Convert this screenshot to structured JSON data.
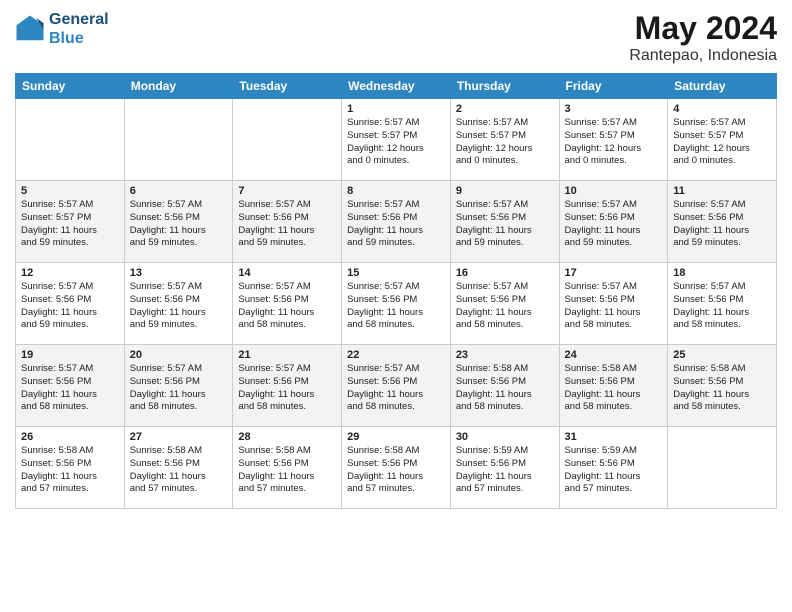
{
  "header": {
    "logo_line1": "General",
    "logo_line2": "Blue",
    "month": "May 2024",
    "location": "Rantepao, Indonesia"
  },
  "weekdays": [
    "Sunday",
    "Monday",
    "Tuesday",
    "Wednesday",
    "Thursday",
    "Friday",
    "Saturday"
  ],
  "weeks": [
    [
      {
        "day": "",
        "info": ""
      },
      {
        "day": "",
        "info": ""
      },
      {
        "day": "",
        "info": ""
      },
      {
        "day": "1",
        "info": "Sunrise: 5:57 AM\nSunset: 5:57 PM\nDaylight: 12 hours\nand 0 minutes."
      },
      {
        "day": "2",
        "info": "Sunrise: 5:57 AM\nSunset: 5:57 PM\nDaylight: 12 hours\nand 0 minutes."
      },
      {
        "day": "3",
        "info": "Sunrise: 5:57 AM\nSunset: 5:57 PM\nDaylight: 12 hours\nand 0 minutes."
      },
      {
        "day": "4",
        "info": "Sunrise: 5:57 AM\nSunset: 5:57 PM\nDaylight: 12 hours\nand 0 minutes."
      }
    ],
    [
      {
        "day": "5",
        "info": "Sunrise: 5:57 AM\nSunset: 5:57 PM\nDaylight: 11 hours\nand 59 minutes."
      },
      {
        "day": "6",
        "info": "Sunrise: 5:57 AM\nSunset: 5:56 PM\nDaylight: 11 hours\nand 59 minutes."
      },
      {
        "day": "7",
        "info": "Sunrise: 5:57 AM\nSunset: 5:56 PM\nDaylight: 11 hours\nand 59 minutes."
      },
      {
        "day": "8",
        "info": "Sunrise: 5:57 AM\nSunset: 5:56 PM\nDaylight: 11 hours\nand 59 minutes."
      },
      {
        "day": "9",
        "info": "Sunrise: 5:57 AM\nSunset: 5:56 PM\nDaylight: 11 hours\nand 59 minutes."
      },
      {
        "day": "10",
        "info": "Sunrise: 5:57 AM\nSunset: 5:56 PM\nDaylight: 11 hours\nand 59 minutes."
      },
      {
        "day": "11",
        "info": "Sunrise: 5:57 AM\nSunset: 5:56 PM\nDaylight: 11 hours\nand 59 minutes."
      }
    ],
    [
      {
        "day": "12",
        "info": "Sunrise: 5:57 AM\nSunset: 5:56 PM\nDaylight: 11 hours\nand 59 minutes."
      },
      {
        "day": "13",
        "info": "Sunrise: 5:57 AM\nSunset: 5:56 PM\nDaylight: 11 hours\nand 59 minutes."
      },
      {
        "day": "14",
        "info": "Sunrise: 5:57 AM\nSunset: 5:56 PM\nDaylight: 11 hours\nand 58 minutes."
      },
      {
        "day": "15",
        "info": "Sunrise: 5:57 AM\nSunset: 5:56 PM\nDaylight: 11 hours\nand 58 minutes."
      },
      {
        "day": "16",
        "info": "Sunrise: 5:57 AM\nSunset: 5:56 PM\nDaylight: 11 hours\nand 58 minutes."
      },
      {
        "day": "17",
        "info": "Sunrise: 5:57 AM\nSunset: 5:56 PM\nDaylight: 11 hours\nand 58 minutes."
      },
      {
        "day": "18",
        "info": "Sunrise: 5:57 AM\nSunset: 5:56 PM\nDaylight: 11 hours\nand 58 minutes."
      }
    ],
    [
      {
        "day": "19",
        "info": "Sunrise: 5:57 AM\nSunset: 5:56 PM\nDaylight: 11 hours\nand 58 minutes."
      },
      {
        "day": "20",
        "info": "Sunrise: 5:57 AM\nSunset: 5:56 PM\nDaylight: 11 hours\nand 58 minutes."
      },
      {
        "day": "21",
        "info": "Sunrise: 5:57 AM\nSunset: 5:56 PM\nDaylight: 11 hours\nand 58 minutes."
      },
      {
        "day": "22",
        "info": "Sunrise: 5:57 AM\nSunset: 5:56 PM\nDaylight: 11 hours\nand 58 minutes."
      },
      {
        "day": "23",
        "info": "Sunrise: 5:58 AM\nSunset: 5:56 PM\nDaylight: 11 hours\nand 58 minutes."
      },
      {
        "day": "24",
        "info": "Sunrise: 5:58 AM\nSunset: 5:56 PM\nDaylight: 11 hours\nand 58 minutes."
      },
      {
        "day": "25",
        "info": "Sunrise: 5:58 AM\nSunset: 5:56 PM\nDaylight: 11 hours\nand 58 minutes."
      }
    ],
    [
      {
        "day": "26",
        "info": "Sunrise: 5:58 AM\nSunset: 5:56 PM\nDaylight: 11 hours\nand 57 minutes."
      },
      {
        "day": "27",
        "info": "Sunrise: 5:58 AM\nSunset: 5:56 PM\nDaylight: 11 hours\nand 57 minutes."
      },
      {
        "day": "28",
        "info": "Sunrise: 5:58 AM\nSunset: 5:56 PM\nDaylight: 11 hours\nand 57 minutes."
      },
      {
        "day": "29",
        "info": "Sunrise: 5:58 AM\nSunset: 5:56 PM\nDaylight: 11 hours\nand 57 minutes."
      },
      {
        "day": "30",
        "info": "Sunrise: 5:59 AM\nSunset: 5:56 PM\nDaylight: 11 hours\nand 57 minutes."
      },
      {
        "day": "31",
        "info": "Sunrise: 5:59 AM\nSunset: 5:56 PM\nDaylight: 11 hours\nand 57 minutes."
      },
      {
        "day": "",
        "info": ""
      }
    ]
  ]
}
